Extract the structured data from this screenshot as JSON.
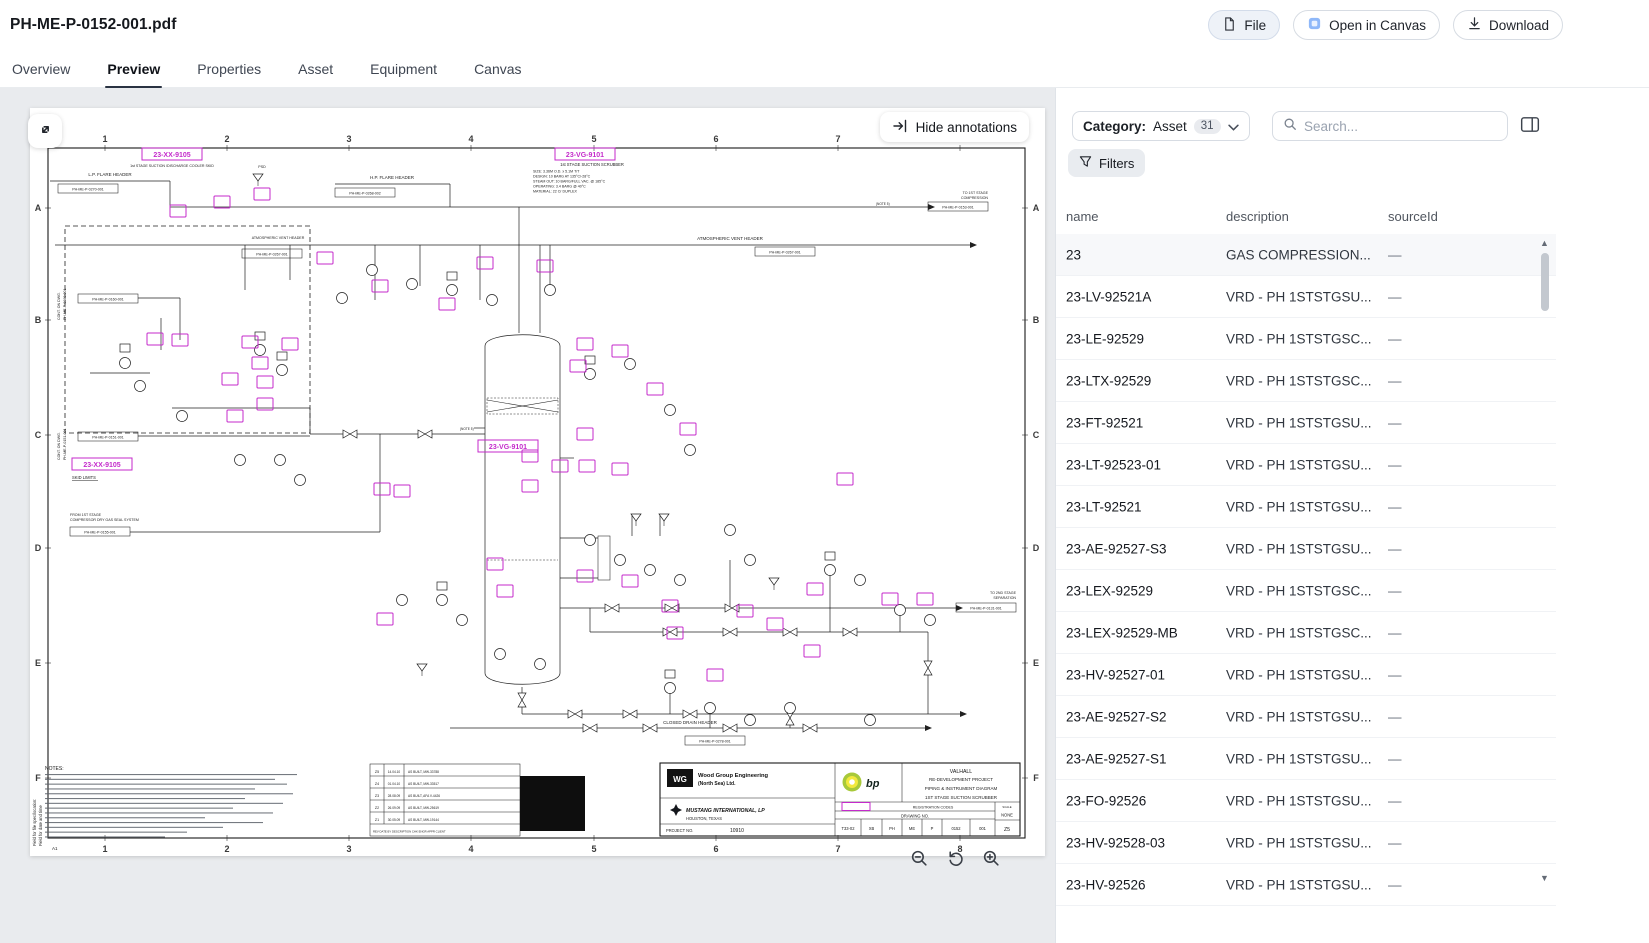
{
  "header": {
    "title": "PH-ME-P-0152-001.pdf",
    "file_button": "File",
    "open_in_canvas_button": "Open in Canvas",
    "download_button": "Download"
  },
  "tabs": {
    "items": [
      {
        "label": "Overview"
      },
      {
        "label": "Preview"
      },
      {
        "label": "Properties"
      },
      {
        "label": "Asset"
      },
      {
        "label": "Equipment"
      },
      {
        "label": "Canvas"
      }
    ],
    "active": "Preview"
  },
  "viewer": {
    "hide_annotations_label": "Hide annotations",
    "annotation_color": "#C42ACB",
    "labeled_annotations": {
      "skid_top": "23-XX-9105",
      "scrubber_top": "23-VG-9101",
      "vessel_tag": "23-VG-9101",
      "skid_mid": "23-XX-9105",
      "skid_limits": "SKID LIMITS"
    },
    "drawing": {
      "grid_rows": [
        "A",
        "B",
        "C",
        "D",
        "E",
        "F"
      ],
      "grid_cols": [
        "1",
        "2",
        "3",
        "4",
        "5",
        "6",
        "7",
        "8"
      ],
      "labels": {
        "skid_title": "1st STAGE SUCTION /DISCHARGE COOLER SKID",
        "scrubber_title": "1st STAGE SUCTION SCRUBBER",
        "scrubber_specs": [
          "SIZE: 3.36M O.D. x 5.1M T/T",
          "DESIGN: 10 BARG AT 135°C/-28°C",
          "STEAM OUT: 10 BARG/FULL VAC. @ 185°C",
          "OPERATING: 3.4 BARG @ 40°C",
          "MATERIAL: 22 Cr DUPLEX"
        ],
        "hp_flare": "H.P. FLARE HEADER",
        "lp_flare": "L.P. FLARE HEADER",
        "atmos_vent": "ATMOSPHERIC VENT HEADER",
        "closed_drain": "CLOSED DRAIN HEADER",
        "to_1st_1": "TO 1ST STAGE",
        "to_1st_2": "COMPRESSION",
        "to_2nd_1": "TO 2ND STAGE",
        "to_2nd_2": "SEPARATION",
        "from_seal_1": "FROM 1ST STAGE",
        "from_seal_2": "COMPRESSOR DRY GAS SEAL SYSTEM",
        "cont_1a": "CONT. ON DWG.",
        "cont_1b": "PH-ME-P-0160-001",
        "cont_2a": "CONT. ON DWG.",
        "cont_2b": "PH-ME-P-0151-001",
        "notes_title": "NOTES:",
        "note5": "(NOTE 5)",
        "psd": "PSD",
        "sheet_corner": "A1",
        "margin_1": "Field for file spec/location:",
        "margin_2": "Field for date and time",
        "ref_boxes": [
          "PH-ME-P-0270-001",
          "PH-ME-P-0268-002",
          "PH-ME-P-0267-001",
          "PH-ME-P-0153-001",
          "PH-ME-P-0155-001",
          "PH-ME-P-0278-001",
          "PH-ME-P-0131-001",
          "PH-ME-P-0160-001",
          "PH-ME-P-0151-001",
          "PH-ME-P-0267-001"
        ]
      },
      "title_block": {
        "wg": "WG",
        "company1": "Wood Group Engineering",
        "company1b": "(North Sea) Ltd.",
        "company2": "MUSTANG INTERNATIONAL, LP",
        "company2_loc": "HOUSTON, TEXAS",
        "project_no_label": "PROJECT NO.",
        "project_no": "10910",
        "bp": "bp",
        "valhall": "VALHALL",
        "redev": "RE-DEVELOPMENT PROJECT",
        "doc_type": "PIPING & INSTRUMENT DIAGRAM",
        "doc_title": "1ST STAGE SUCTION SCRUBBER",
        "registration": "REGISTRATION CODES",
        "drawing_no_label": "DRAWING NO.",
        "cells": [
          "T33-02",
          "XB",
          "PH",
          "ME",
          "P",
          "0152",
          "001"
        ],
        "scale_label": "SCALE",
        "scale": "NONE",
        "rev": "Z5"
      },
      "revisions": {
        "header": "REV  DATE   BY   DESCRIPTION                CHK ENGR APPR CLIENT",
        "rows": [
          [
            "Z5",
            "14.04.10",
            "AS BUILT, MW-33788"
          ],
          [
            "Z4",
            "01.04.10",
            "AS BUILT, MW-33517"
          ],
          [
            "Z3",
            "28.08.09",
            "AS BUILT, AFA V-4426"
          ],
          [
            "Z2",
            "26.09.09",
            "AS BUILT, MW-25619"
          ],
          [
            "Z1",
            "30.05.09",
            "AS BUILT, MW-19144"
          ]
        ]
      }
    }
  },
  "panel": {
    "category": {
      "label": "Category:",
      "value": "Asset",
      "count": "31"
    },
    "search_placeholder": "Search...",
    "filters_label": "Filters",
    "columns": [
      "name",
      "description",
      "sourceId"
    ],
    "rows": [
      {
        "name": "23",
        "description": "GAS COMPRESSION...",
        "sourceId": "—"
      },
      {
        "name": "23-LV-92521A",
        "description": "VRD - PH 1STSTGSU...",
        "sourceId": "—"
      },
      {
        "name": "23-LE-92529",
        "description": "VRD - PH 1STSTGSC...",
        "sourceId": "—"
      },
      {
        "name": "23-LTX-92529",
        "description": "VRD - PH 1STSTGSC...",
        "sourceId": "—"
      },
      {
        "name": "23-FT-92521",
        "description": "VRD - PH 1STSTGSU...",
        "sourceId": "—"
      },
      {
        "name": "23-LT-92523-01",
        "description": "VRD - PH 1STSTGSU...",
        "sourceId": "—"
      },
      {
        "name": "23-LT-92521",
        "description": "VRD - PH 1STSTGSU...",
        "sourceId": "—"
      },
      {
        "name": "23-AE-92527-S3",
        "description": "VRD - PH 1STSTGSU...",
        "sourceId": "—"
      },
      {
        "name": "23-LEX-92529",
        "description": "VRD - PH 1STSTGSC...",
        "sourceId": "—"
      },
      {
        "name": "23-LEX-92529-MB",
        "description": "VRD - PH 1STSTGSC...",
        "sourceId": "—"
      },
      {
        "name": "23-HV-92527-01",
        "description": "VRD - PH 1STSTGSU...",
        "sourceId": "—"
      },
      {
        "name": "23-AE-92527-S2",
        "description": "VRD - PH 1STSTGSU...",
        "sourceId": "—"
      },
      {
        "name": "23-AE-92527-S1",
        "description": "VRD - PH 1STSTGSU...",
        "sourceId": "—"
      },
      {
        "name": "23-FO-92526",
        "description": "VRD - PH 1STSTGSU...",
        "sourceId": "—"
      },
      {
        "name": "23-HV-92528-03",
        "description": "VRD - PH 1STSTGSU...",
        "sourceId": "—"
      },
      {
        "name": "23-HV-92526",
        "description": "VRD - PH 1STSTGSU...",
        "sourceId": "—"
      }
    ]
  }
}
